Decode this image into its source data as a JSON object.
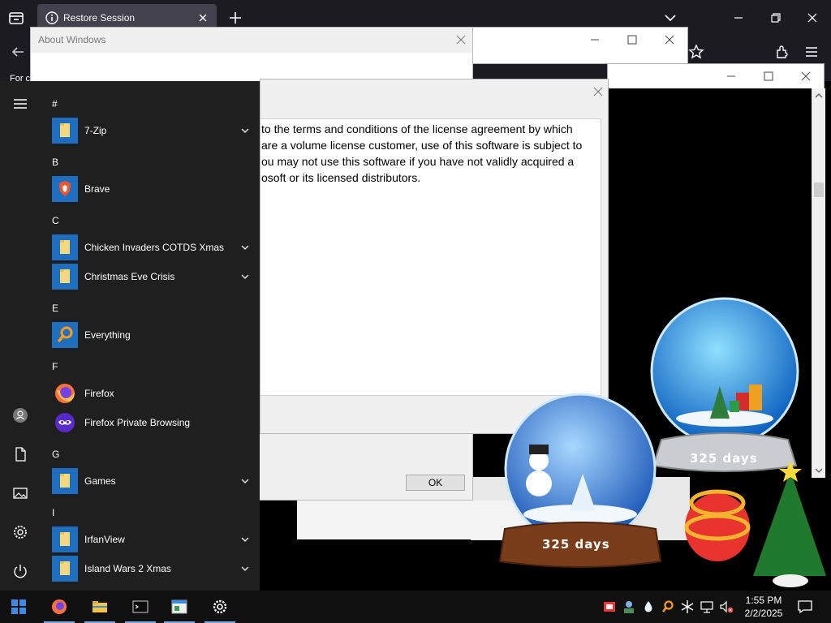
{
  "browser": {
    "tab_title": "Restore Session",
    "bookmark_hint": "For c"
  },
  "about": {
    "title": "About Windows",
    "ok_label": "OK"
  },
  "license": {
    "lines": [
      "to the terms and conditions of the license agreement by which",
      "are a volume license customer, use of this software is subject to",
      "ou may not use this software if you have not validly acquired a",
      "osoft or its licensed distributors."
    ]
  },
  "start_menu": {
    "groups": [
      {
        "letter": "#",
        "apps": [
          {
            "label": "7-Zip",
            "expandable": true
          }
        ]
      },
      {
        "letter": "B",
        "apps": [
          {
            "label": "Brave",
            "expandable": false
          }
        ]
      },
      {
        "letter": "C",
        "apps": [
          {
            "label": "Chicken Invaders COTDS Xmas",
            "expandable": true
          },
          {
            "label": "Christmas Eve Crisis",
            "expandable": true
          }
        ]
      },
      {
        "letter": "E",
        "apps": [
          {
            "label": "Everything",
            "expandable": false
          }
        ]
      },
      {
        "letter": "F",
        "apps": [
          {
            "label": "Firefox",
            "expandable": false
          },
          {
            "label": "Firefox Private Browsing",
            "expandable": false
          }
        ]
      },
      {
        "letter": "G",
        "apps": [
          {
            "label": "Games",
            "expandable": true
          }
        ]
      },
      {
        "letter": "I",
        "apps": [
          {
            "label": "IrfanView",
            "expandable": true
          },
          {
            "label": "Island Wars 2 Xmas",
            "expandable": true
          }
        ]
      }
    ]
  },
  "gadgets": {
    "globe_small_text": "325 days",
    "globe_large_text": "325 days"
  },
  "taskbar": {
    "time": "1:55 PM",
    "date": "2/2/2025"
  },
  "colors": {
    "accent": "#1e6fbf",
    "start_bg": "#1f1f1f",
    "taskbar_bg": "#101010",
    "browser_bg": "#1c1b22"
  }
}
